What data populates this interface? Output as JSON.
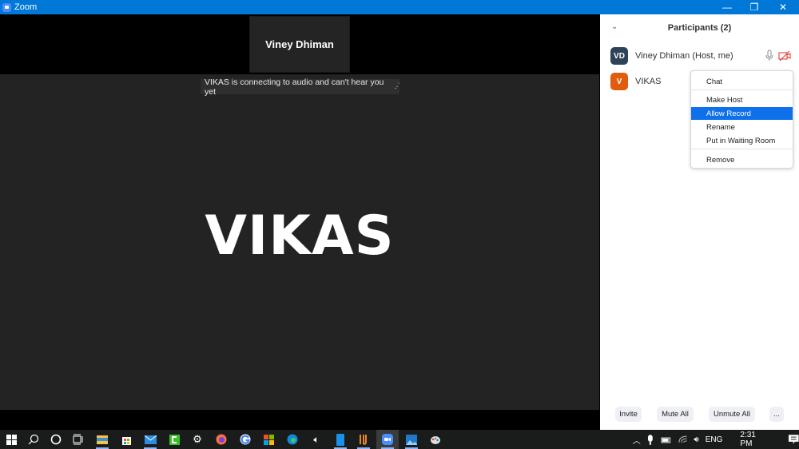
{
  "window": {
    "title": "Zoom",
    "controls": {
      "minimize": "—",
      "maximize": "❐",
      "close": "✕"
    }
  },
  "meeting": {
    "thumbnail_name": "Viney Dhiman",
    "notice_text": "VIKAS is connecting to audio and can't hear you yet",
    "notice_icon": "connecting-dots-icon",
    "active_speaker_name": "VIKAS"
  },
  "participants_panel": {
    "collapse_glyph": "⌄",
    "title": "Participants (2)",
    "participants": [
      {
        "initials": "VD",
        "name": "Viney Dhiman (Host, me)",
        "avatar_color": "#2d4458",
        "mic": "mic-icon",
        "video": "video-off-icon"
      },
      {
        "initials": "V",
        "name": "VIKAS",
        "avatar_color": "#e05d0e"
      }
    ],
    "context_menu": {
      "items": [
        "Chat",
        "Make Host",
        "Allow Record",
        "Rename",
        "Put in Waiting Room",
        "Remove"
      ],
      "selected": "Allow Record"
    },
    "footer_buttons": {
      "invite": "Invite",
      "mute_all": "Mute All",
      "unmute_all": "Unmute All",
      "more": "..."
    }
  },
  "colors": {
    "titlebar": "#0078d7",
    "menu_highlight": "#0e71eb",
    "video_off": "#e0312b"
  },
  "taskbar": {
    "apps": [
      "start-icon",
      "search-icon",
      "cortana-icon",
      "task-view-icon",
      "file-explorer-icon",
      "store-icon",
      "mail-icon",
      "camtasia-icon",
      "settings-icon",
      "firefox-icon",
      "chrome-icon",
      "microsoft-icon",
      "edge-icon",
      "volume-app-icon",
      "phone-app-icon",
      "app-icon",
      "zoom-icon",
      "photos-icon",
      "paint-icon"
    ],
    "tray": {
      "language": "ENG",
      "time": "2:31 PM"
    }
  }
}
